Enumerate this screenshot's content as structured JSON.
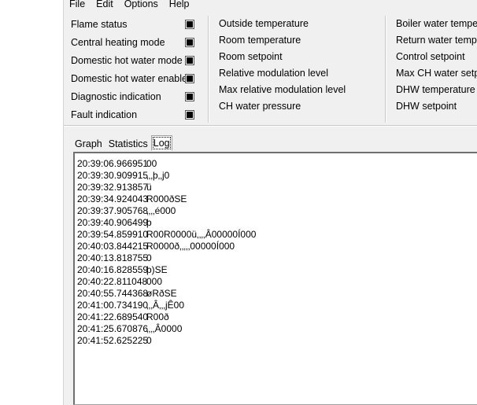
{
  "menu": [
    "File",
    "Edit",
    "Options",
    "Help"
  ],
  "status_flags": [
    "Flame status",
    "Central heating mode",
    "Domestic hot water mode",
    "Domestic hot water enable",
    "Diagnostic indication",
    "Fault indication"
  ],
  "readings_col1": [
    "Outside temperature",
    "Room temperature",
    "Room setpoint",
    "Relative modulation level",
    "Max relative modulation level",
    "CH water pressure"
  ],
  "readings_col2": [
    "Boiler water temperature",
    "Return water temperature",
    "Control setpoint",
    "Max CH water setpoint",
    "DHW temperature",
    "DHW setpoint"
  ],
  "tabs": [
    "Graph",
    "Statistics",
    "Log"
  ],
  "active_tab": "Log",
  "log": [
    {
      "time": "20:39:06.966951",
      "msg": "00"
    },
    {
      "time": "20:39:30.909915",
      "msg": "‚‚‚þ‚‚j0"
    },
    {
      "time": "20:39:32.913857",
      "msg": "ü"
    },
    {
      "time": "20:39:34.924043",
      "msg": "R000ðSE"
    },
    {
      "time": "20:39:37.905768",
      "msg": "‚‚‚‚é000"
    },
    {
      "time": "20:39:40.906499",
      "msg": "þ"
    },
    {
      "time": "20:39:54.859910",
      "msg": "R00R0000ü‚‚‚‚Â00000Í000"
    },
    {
      "time": "20:40:03.844215",
      "msg": "R0000ð‚‚‚‚‚00000Í000"
    },
    {
      "time": "20:40:13.818755",
      "msg": "0"
    },
    {
      "time": "20:40:16.828559",
      "msg": "þ)SE"
    },
    {
      "time": "20:40:22.811048",
      "msg": "000"
    },
    {
      "time": "20:40:55.744368",
      "msg": "øRðSE"
    },
    {
      "time": "20:41:00.734190",
      "msg": "‚‚‚Â‚‚‚jÊ00"
    },
    {
      "time": "20:41:22.689540",
      "msg": "R00ð"
    },
    {
      "time": "20:41:25.670876",
      "msg": "‚‚‚‚Â0000"
    },
    {
      "time": "20:41:52.625225",
      "msg": "0"
    }
  ]
}
